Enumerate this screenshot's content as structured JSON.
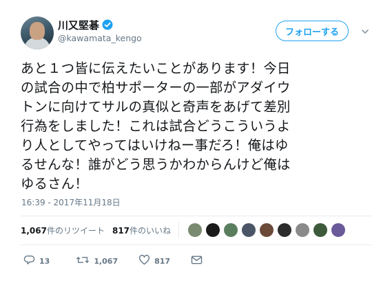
{
  "tweet": {
    "author": {
      "name": "川又堅碁",
      "handle": "@kawamata_kengo",
      "verified": true
    },
    "follow_button": {
      "label": "フォローする"
    },
    "text_lines": [
      "あと１つ皆に伝えたいことがあります！今日",
      "の試合の中で柏サポーターの一部がアダイウ",
      "トンに向けてサルの真似と奇声をあげて差別",
      "行為をしました！これは試合どうこういうよ",
      "り人としてやってはいけねー事だろ！俺はゆ",
      "るせんな！誰がどう思うかわからんけど俺は",
      "ゆるさん！"
    ],
    "timestamp": "16:39 - 2017年11月18日",
    "stats": {
      "retweets_count": "1,067",
      "retweets_label": "件のリツイート",
      "likes_count": "817",
      "likes_label": "件のいいね"
    },
    "liker_avatars": [
      {
        "icon": "avatar-icon",
        "color": "#7a8a70"
      },
      {
        "icon": "avatar-icon",
        "color": "#1b1b1b"
      },
      {
        "icon": "avatar-icon",
        "color": "#5a7d5e"
      },
      {
        "icon": "avatar-icon",
        "color": "#4a5566"
      },
      {
        "icon": "avatar-icon",
        "color": "#6b4a3a"
      },
      {
        "icon": "avatar-icon",
        "color": "#2c2c2c"
      },
      {
        "icon": "avatar-icon",
        "color": "#8a8a8a"
      },
      {
        "icon": "avatar-icon",
        "color": "#3d5a3a"
      },
      {
        "icon": "avatar-icon",
        "color": "#6a5a9a"
      }
    ],
    "actions": {
      "reply_count": "13",
      "retweet_count": "1,067",
      "like_count": "817"
    },
    "colors": {
      "accent": "#1da1f2",
      "muted": "#657786",
      "divider": "#e6ecf0"
    }
  }
}
